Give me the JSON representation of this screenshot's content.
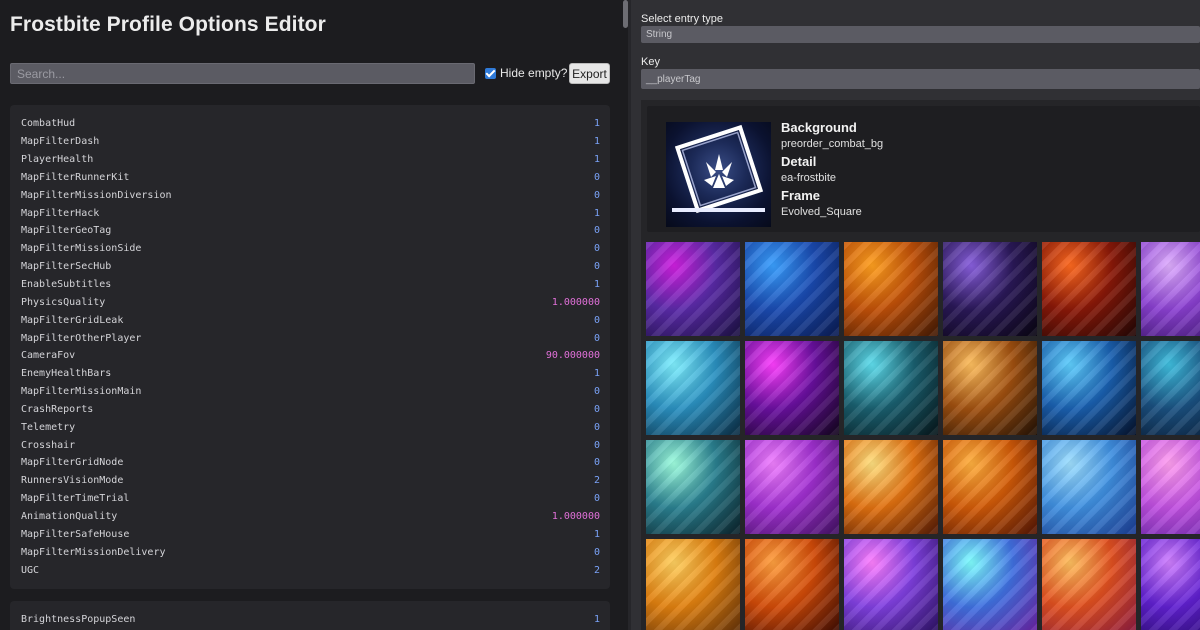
{
  "app": {
    "title": "Frostbite Profile Options Editor"
  },
  "toolbar": {
    "search_placeholder": "Search...",
    "search_value": "",
    "hide_empty_label": "Hide empty?",
    "hide_empty_checked": true,
    "export_label": "Export"
  },
  "settings_groups": [
    {
      "rows": [
        {
          "key": "CombatHud",
          "value": "1",
          "type": "int"
        },
        {
          "key": "MapFilterDash",
          "value": "1",
          "type": "int"
        },
        {
          "key": "PlayerHealth",
          "value": "1",
          "type": "int"
        },
        {
          "key": "MapFilterRunnerKit",
          "value": "0",
          "type": "int"
        },
        {
          "key": "MapFilterMissionDiversion",
          "value": "0",
          "type": "int"
        },
        {
          "key": "MapFilterHack",
          "value": "1",
          "type": "int"
        },
        {
          "key": "MapFilterGeoTag",
          "value": "0",
          "type": "int"
        },
        {
          "key": "MapFilterMissionSide",
          "value": "0",
          "type": "int"
        },
        {
          "key": "MapFilterSecHub",
          "value": "0",
          "type": "int"
        },
        {
          "key": "EnableSubtitles",
          "value": "1",
          "type": "int"
        },
        {
          "key": "PhysicsQuality",
          "value": "1.000000",
          "type": "float"
        },
        {
          "key": "MapFilterGridLeak",
          "value": "0",
          "type": "int"
        },
        {
          "key": "MapFilterOtherPlayer",
          "value": "0",
          "type": "int"
        },
        {
          "key": "CameraFov",
          "value": "90.000000",
          "type": "float"
        },
        {
          "key": "EnemyHealthBars",
          "value": "1",
          "type": "int"
        },
        {
          "key": "MapFilterMissionMain",
          "value": "0",
          "type": "int"
        },
        {
          "key": "CrashReports",
          "value": "0",
          "type": "int"
        },
        {
          "key": "Telemetry",
          "value": "0",
          "type": "int"
        },
        {
          "key": "Crosshair",
          "value": "0",
          "type": "int"
        },
        {
          "key": "MapFilterGridNode",
          "value": "0",
          "type": "int"
        },
        {
          "key": "RunnersVisionMode",
          "value": "2",
          "type": "int"
        },
        {
          "key": "MapFilterTimeTrial",
          "value": "0",
          "type": "int"
        },
        {
          "key": "AnimationQuality",
          "value": "1.000000",
          "type": "float"
        },
        {
          "key": "MapFilterSafeHouse",
          "value": "1",
          "type": "int"
        },
        {
          "key": "MapFilterMissionDelivery",
          "value": "0",
          "type": "int"
        },
        {
          "key": "UGC",
          "value": "2",
          "type": "int"
        }
      ]
    },
    {
      "rows": [
        {
          "key": "BrightnessPopupSeen",
          "value": "1",
          "type": "int"
        }
      ]
    }
  ],
  "editor": {
    "entry_type_label": "Select entry type",
    "entry_type_value": "String",
    "key_label": "Key",
    "key_value": "__playerTag"
  },
  "player_tag": {
    "background_label": "Background",
    "background_value": "preorder_combat_bg",
    "detail_label": "Detail",
    "detail_value": "ea-frostbite",
    "frame_label": "Frame",
    "frame_value": "Evolved_Square"
  },
  "background_tiles": [
    {
      "name": "background-tile-purple-hex",
      "colors": [
        "#d020e0",
        "#5a2aa8",
        "#1a1040"
      ]
    },
    {
      "name": "background-tile-blue-hex",
      "colors": [
        "#3aa0ff",
        "#1a4ab0",
        "#0a1a50"
      ]
    },
    {
      "name": "background-tile-orange-hex",
      "colors": [
        "#ffa020",
        "#c05008",
        "#401804"
      ]
    },
    {
      "name": "background-tile-dark-crystal",
      "colors": [
        "#8a60e0",
        "#2a1858",
        "#080410"
      ]
    },
    {
      "name": "background-tile-red-shards",
      "colors": [
        "#ff6a20",
        "#8a1808",
        "#200604"
      ]
    },
    {
      "name": "background-tile-violet-pillars",
      "colors": [
        "#e0b0ff",
        "#8a40d0",
        "#301060"
      ]
    },
    {
      "name": "background-tile-cyan-pillars",
      "colors": [
        "#80f0ff",
        "#2a90c0",
        "#0a2a40"
      ]
    },
    {
      "name": "background-tile-magenta-shards",
      "colors": [
        "#ff40ff",
        "#6a10a0",
        "#10041a"
      ]
    },
    {
      "name": "background-tile-teal-crystal",
      "colors": [
        "#60e0f0",
        "#1a6070",
        "#061418"
      ]
    },
    {
      "name": "background-tile-gold-crystal",
      "colors": [
        "#ffc060",
        "#a05010",
        "#201004"
      ]
    },
    {
      "name": "background-tile-blue-shards",
      "colors": [
        "#60d0ff",
        "#1a60b0",
        "#041028"
      ]
    },
    {
      "name": "background-tile-teal-network",
      "colors": [
        "#40c0e0",
        "#1a5080",
        "#08142a"
      ]
    },
    {
      "name": "background-tile-teal-chamber",
      "colors": [
        "#a0ffe0",
        "#2a8090",
        "#0a2028"
      ]
    },
    {
      "name": "background-tile-violet-network",
      "colors": [
        "#f080ff",
        "#a030d0",
        "#401060"
      ]
    },
    {
      "name": "background-tile-orange-chamber",
      "colors": [
        "#ffe080",
        "#e07010",
        "#501804"
      ]
    },
    {
      "name": "background-tile-orange-network",
      "colors": [
        "#ffb040",
        "#d05a08",
        "#501404"
      ]
    },
    {
      "name": "background-tile-blue-hex-light",
      "colors": [
        "#a0e0ff",
        "#4090e0",
        "#1a3a90"
      ]
    },
    {
      "name": "background-tile-pink-hex",
      "colors": [
        "#ffa0f0",
        "#c050e0",
        "#5a20a0"
      ]
    },
    {
      "name": "background-tile-gold-hex",
      "colors": [
        "#ffd060",
        "#e08010",
        "#603008"
      ]
    },
    {
      "name": "background-tile-orange-ripple",
      "colors": [
        "#ffa040",
        "#d04a08",
        "#3a0a02"
      ]
    },
    {
      "name": "background-tile-purple-ribbons",
      "colors": [
        "#ff80ff",
        "#8040e0",
        "#2a1060"
      ]
    },
    {
      "name": "background-tile-rainbow-ribbons",
      "colors": [
        "#80ffff",
        "#4070e0",
        "#6a20a0"
      ]
    },
    {
      "name": "background-tile-orange-ribbons",
      "colors": [
        "#ffc060",
        "#e05020",
        "#8a1a40"
      ]
    },
    {
      "name": "background-tile-violet-ribbons",
      "colors": [
        "#d080ff",
        "#6020d0",
        "#200860"
      ]
    }
  ]
}
